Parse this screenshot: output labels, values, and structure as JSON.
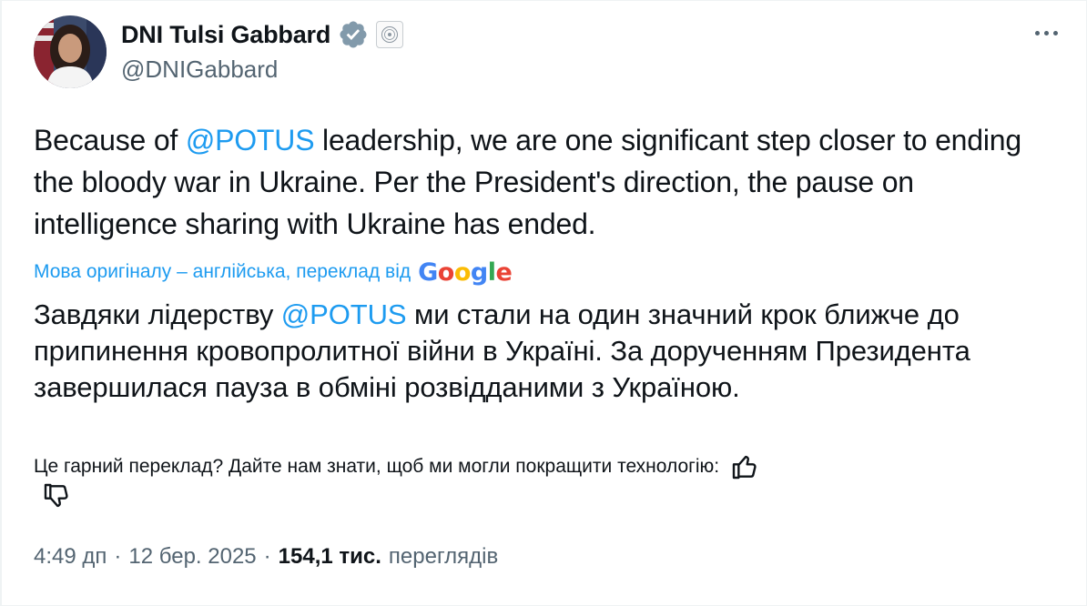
{
  "author": {
    "display_name": "DNI Tulsi Gabbard",
    "handle": "@DNIGabbard"
  },
  "tweet": {
    "text_parts": [
      "Because of ",
      "@POTUS",
      " leadership, we are one significant step closer to ending the bloody war in Ukraine. Per the President's direction, the pause on intelligence sharing with Ukraine has ended."
    ]
  },
  "translation": {
    "label": "Мова оригіналу – англійська, переклад від",
    "provider": "Google",
    "text_parts": [
      "Завдяки лідерству ",
      "@POTUS",
      " ми стали на один значний крок ближче до припинення кровопролитної війни в Україні. За дорученням Президента завершилася пауза в обміні розвідданими з Україною."
    ],
    "feedback_prompt": "Це гарний переклад? Дайте нам знати, щоб ми могли покращити технологію:"
  },
  "meta": {
    "time": "4:49 дп",
    "separator": "·",
    "date": "12 бер. 2025",
    "views_count": "154,1 тис.",
    "views_label": "переглядів"
  },
  "colors": {
    "accent": "#1d9bf0",
    "secondary_text": "#536471",
    "primary_text": "#0f1419"
  },
  "icons": [
    "verified-badge-icon",
    "government-seal-icon",
    "more-icon",
    "thumbs-up-icon",
    "thumbs-down-icon",
    "google-logo"
  ]
}
